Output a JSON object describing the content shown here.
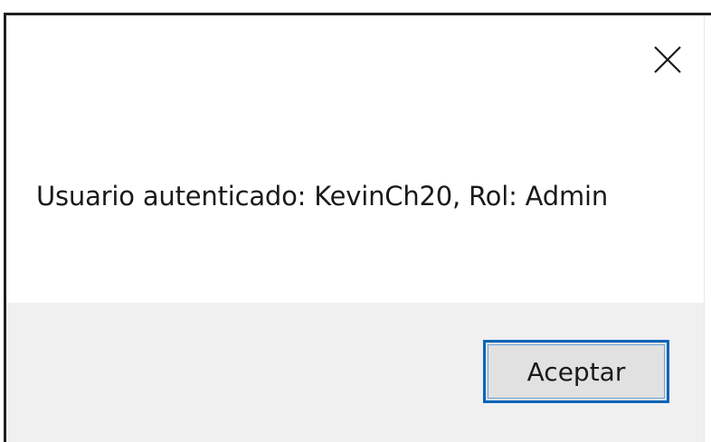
{
  "dialog": {
    "message": "Usuario autenticado: KevinCh20, Rol: Admin",
    "ok_label": "Aceptar",
    "close_icon": "close-icon"
  },
  "colors": {
    "content_bg": "#ffffff",
    "footer_bg": "#f0f0f0",
    "button_bg": "#e1e1e1",
    "button_focus_border": "#0a64b8",
    "text": "#1a1a1a"
  }
}
